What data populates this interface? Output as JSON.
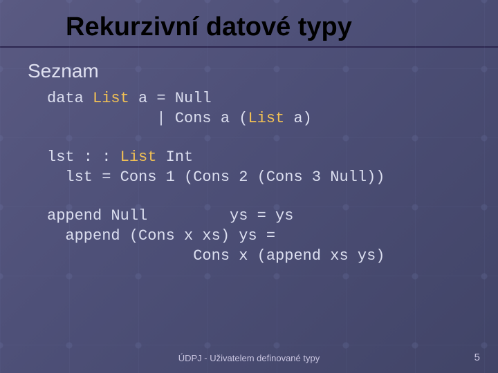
{
  "title": "Rekurzivní datové typy",
  "section": "Seznam",
  "code1": {
    "p1": "data ",
    "p2": "List",
    "p3": " a = Null",
    "p4": "            | Cons a (",
    "p5": "List",
    "p6": " a)"
  },
  "code2": {
    "p1": "lst : : ",
    "p2": "List",
    "p3": " Int",
    "p4": "  lst = Cons 1 (Cons 2 (Cons 3 Null))"
  },
  "code3": {
    "l1": "append Null         ys = ys",
    "l2": "  append (Cons x xs) ys =",
    "l3": "                Cons x (append xs ys)"
  },
  "footer_center": "ÚDPJ - Uživatelem definované typy",
  "page_number": "5"
}
